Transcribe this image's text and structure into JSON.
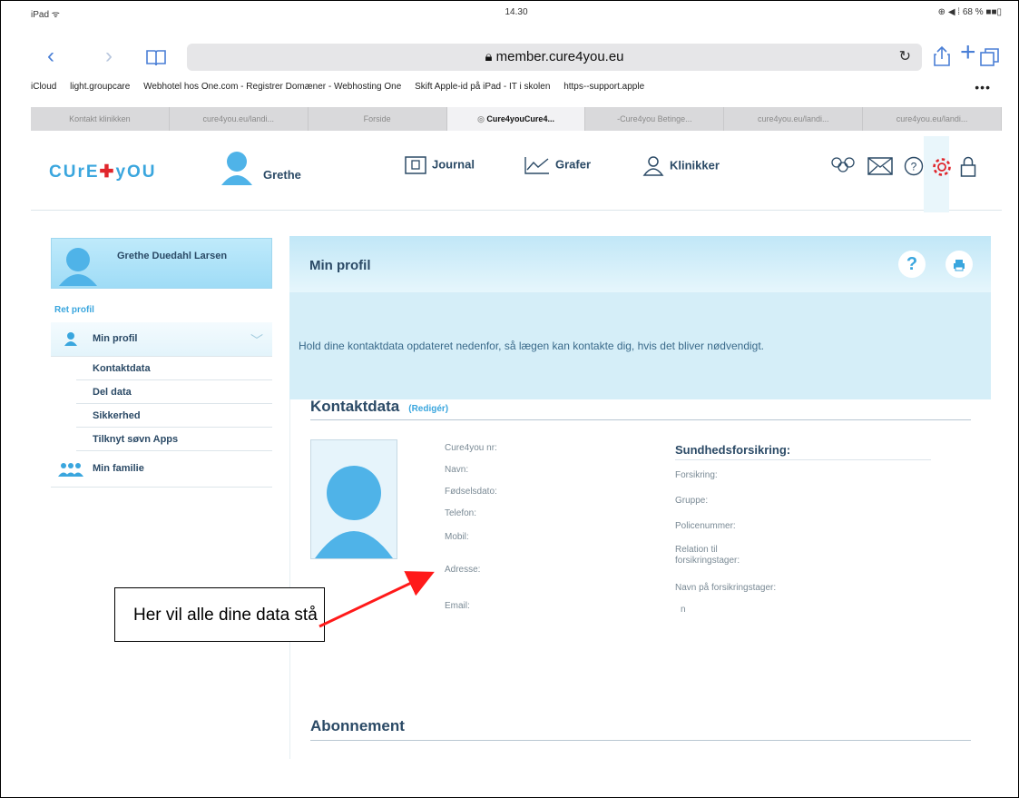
{
  "status_bar": {
    "left": "iPad ᯤ",
    "time": "14.30",
    "right": "⊕ ◀ ⁞ 68 % ■■▯"
  },
  "browser": {
    "url": "member.cure4you.eu",
    "bookmarks": [
      "iCloud",
      "light.groupcare",
      "Webhotel hos One.com - Registrer Domæner - Webhosting One",
      "Skift Apple-id på iPad - IT i skolen",
      "https--support.apple"
    ],
    "more": "•••",
    "tabs": [
      {
        "label": "Kontakt klinikken",
        "active": false
      },
      {
        "label": "cure4you.eu/landi...",
        "active": false
      },
      {
        "label": "Forside",
        "active": false
      },
      {
        "label": "Cure4youCure4...",
        "active": true
      },
      {
        "label": "-Cure4you Betinge...",
        "active": false
      },
      {
        "label": "cure4you.eu/landi...",
        "active": false
      },
      {
        "label": "cure4you.eu/landi...",
        "active": false
      }
    ]
  },
  "header": {
    "logo_a": "CUrE",
    "logo_b": "yOU",
    "user_name": "Grethe",
    "menu": {
      "journal": "Journal",
      "grafer": "Grafer",
      "klinikker": "Klinikker"
    }
  },
  "sidebar": {
    "user_full_name": "Grethe Duedahl Larsen",
    "edit_link": "Ret profil",
    "section": "Min profil",
    "items": [
      "Kontaktdata",
      "Del data",
      "Sikkerhed",
      "Tilknyt søvn Apps"
    ],
    "family": "Min familie"
  },
  "panel": {
    "title": "Min profil",
    "help": "?",
    "intro": "Hold dine kontaktdata opdateret nedenfor, så lægen kan kontakte dig, hvis det bliver nødvendigt."
  },
  "contact": {
    "title": "Kontaktdata",
    "edit": "(Redigér)",
    "labels": [
      "Cure4you nr:",
      "Navn:",
      "Fødselsdato:",
      "Telefon:",
      "Mobil:",
      "Adresse:",
      "Email:"
    ],
    "stray": "n"
  },
  "insurance": {
    "title": "Sundhedsforsikring:",
    "labels": [
      "Forsikring:",
      "Gruppe:",
      "Policenummer:",
      "Relation til forsikringstager:",
      "Navn på forsikringstager:"
    ]
  },
  "subscription": {
    "title": "Abonnement"
  },
  "callout": {
    "text": "Her vil alle dine data stå"
  }
}
